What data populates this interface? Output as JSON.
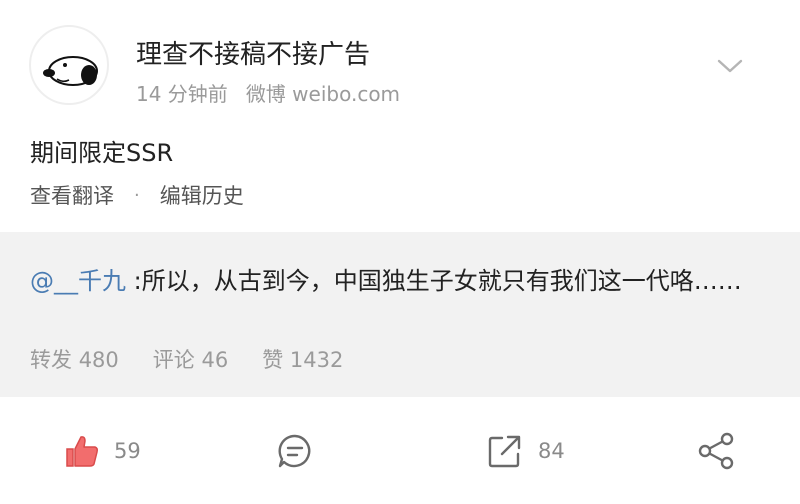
{
  "post": {
    "author": "理查不接稿不接广告",
    "time": "14 分钟前",
    "source": "微博 weibo.com",
    "content": "期间限定SSR",
    "translate_label": "查看翻译",
    "separator": "·",
    "edit_history_label": "编辑历史"
  },
  "repost": {
    "mention": "@__千九",
    "text": " :所以，从古到今，中国独生子女就只有我们这一代咯……",
    "stats": [
      {
        "label": "转发",
        "value": "480"
      },
      {
        "label": "评论",
        "value": "46"
      },
      {
        "label": "赞",
        "value": "1432"
      }
    ]
  },
  "toolbar": {
    "like_count": "59",
    "repost_count": "84"
  },
  "colors": {
    "accent_like": "#f26d6d",
    "mention": "#4a7cb3",
    "repost_bg": "#f2f2f2",
    "muted": "#9a9a9a"
  },
  "icons": {
    "avatar": "snoopy-avatar",
    "more": "chevron-down-icon",
    "like": "thumbs-up-icon",
    "comment": "comment-icon",
    "repost": "repost-arrow-icon",
    "share": "share-icon"
  }
}
